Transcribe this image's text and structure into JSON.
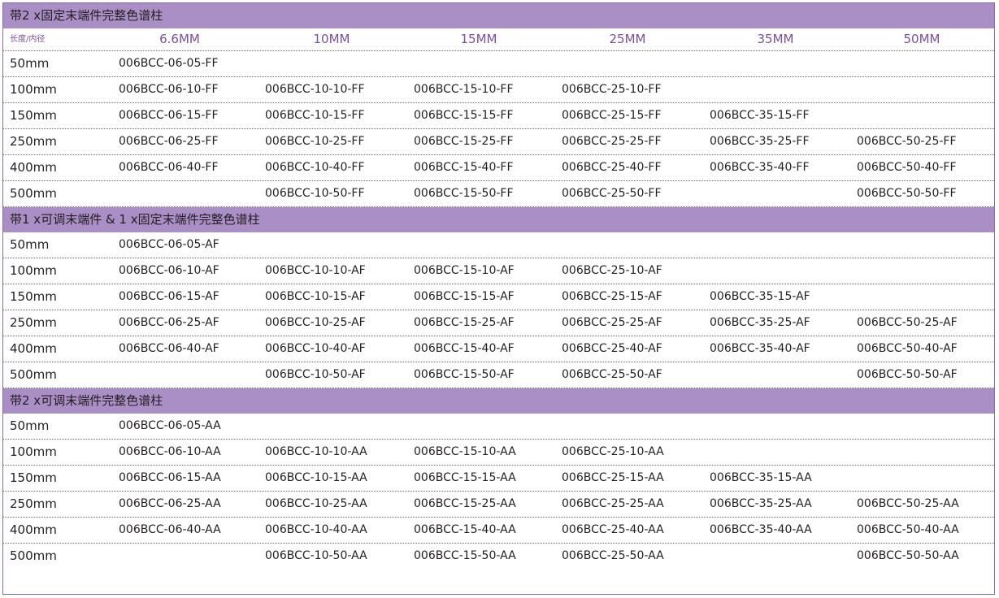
{
  "header": {
    "label": "长度/内径",
    "columns": [
      "6.6MM",
      "10MM",
      "15MM",
      "25MM",
      "35MM",
      "50MM"
    ]
  },
  "sections": [
    {
      "title": "带2 x固定末端件完整色谱柱",
      "rows": [
        {
          "length": "50mm",
          "cells": [
            "006BCC-06-05-FF",
            "",
            "",
            "",
            "",
            ""
          ]
        },
        {
          "length": "100mm",
          "cells": [
            "006BCC-06-10-FF",
            "006BCC-10-10-FF",
            "006BCC-15-10-FF",
            "006BCC-25-10-FF",
            "",
            ""
          ]
        },
        {
          "length": "150mm",
          "cells": [
            "006BCC-06-15-FF",
            "006BCC-10-15-FF",
            "006BCC-15-15-FF",
            "006BCC-25-15-FF",
            "006BCC-35-15-FF",
            ""
          ]
        },
        {
          "length": "250mm",
          "cells": [
            "006BCC-06-25-FF",
            "006BCC-10-25-FF",
            "006BCC-15-25-FF",
            "006BCC-25-25-FF",
            "006BCC-35-25-FF",
            "006BCC-50-25-FF"
          ]
        },
        {
          "length": "400mm",
          "cells": [
            "006BCC-06-40-FF",
            "006BCC-10-40-FF",
            "006BCC-15-40-FF",
            "006BCC-25-40-FF",
            "006BCC-35-40-FF",
            "006BCC-50-40-FF"
          ]
        },
        {
          "length": "500mm",
          "cells": [
            "",
            "006BCC-10-50-FF",
            "006BCC-15-50-FF",
            "006BCC-25-50-FF",
            "",
            "006BCC-50-50-FF"
          ]
        }
      ]
    },
    {
      "title": "带1 x可调末端件 & 1 x固定末端件完整色谱柱",
      "rows": [
        {
          "length": "50mm",
          "cells": [
            "006BCC-06-05-AF",
            "",
            "",
            "",
            "",
            ""
          ]
        },
        {
          "length": "100mm",
          "cells": [
            "006BCC-06-10-AF",
            "006BCC-10-10-AF",
            "006BCC-15-10-AF",
            "006BCC-25-10-AF",
            "",
            ""
          ]
        },
        {
          "length": "150mm",
          "cells": [
            "006BCC-06-15-AF",
            "006BCC-10-15-AF",
            "006BCC-15-15-AF",
            "006BCC-25-15-AF",
            "006BCC-35-15-AF",
            ""
          ]
        },
        {
          "length": "250mm",
          "cells": [
            "006BCC-06-25-AF",
            "006BCC-10-25-AF",
            "006BCC-15-25-AF",
            "006BCC-25-25-AF",
            "006BCC-35-25-AF",
            "006BCC-50-25-AF"
          ]
        },
        {
          "length": "400mm",
          "cells": [
            "006BCC-06-40-AF",
            "006BCC-10-40-AF",
            "006BCC-15-40-AF",
            "006BCC-25-40-AF",
            "006BCC-35-40-AF",
            "006BCC-50-40-AF"
          ]
        },
        {
          "length": "500mm",
          "cells": [
            "",
            "006BCC-10-50-AF",
            "006BCC-15-50-AF",
            "006BCC-25-50-AF",
            "",
            "006BCC-50-50-AF"
          ]
        }
      ]
    },
    {
      "title": "带2 x可调末端件完整色谱柱",
      "rows": [
        {
          "length": "50mm",
          "cells": [
            "006BCC-06-05-AA",
            "",
            "",
            "",
            "",
            ""
          ]
        },
        {
          "length": "100mm",
          "cells": [
            "006BCC-06-10-AA",
            "006BCC-10-10-AA",
            "006BCC-15-10-AA",
            "006BCC-25-10-AA",
            "",
            ""
          ]
        },
        {
          "length": "150mm",
          "cells": [
            "006BCC-06-15-AA",
            "006BCC-10-15-AA",
            "006BCC-15-15-AA",
            "006BCC-25-15-AA",
            "006BCC-35-15-AA",
            ""
          ]
        },
        {
          "length": "250mm",
          "cells": [
            "006BCC-06-25-AA",
            "006BCC-10-25-AA",
            "006BCC-15-25-AA",
            "006BCC-25-25-AA",
            "006BCC-35-25-AA",
            "006BCC-50-25-AA"
          ]
        },
        {
          "length": "400mm",
          "cells": [
            "006BCC-06-40-AA",
            "006BCC-10-40-AA",
            "006BCC-15-40-AA",
            "006BCC-25-40-AA",
            "006BCC-35-40-AA",
            "006BCC-50-40-AA"
          ]
        },
        {
          "length": "500mm",
          "cells": [
            "",
            "006BCC-10-50-AA",
            "006BCC-15-50-AA",
            "006BCC-25-50-AA",
            "",
            "006BCC-50-50-AA"
          ]
        }
      ]
    }
  ]
}
